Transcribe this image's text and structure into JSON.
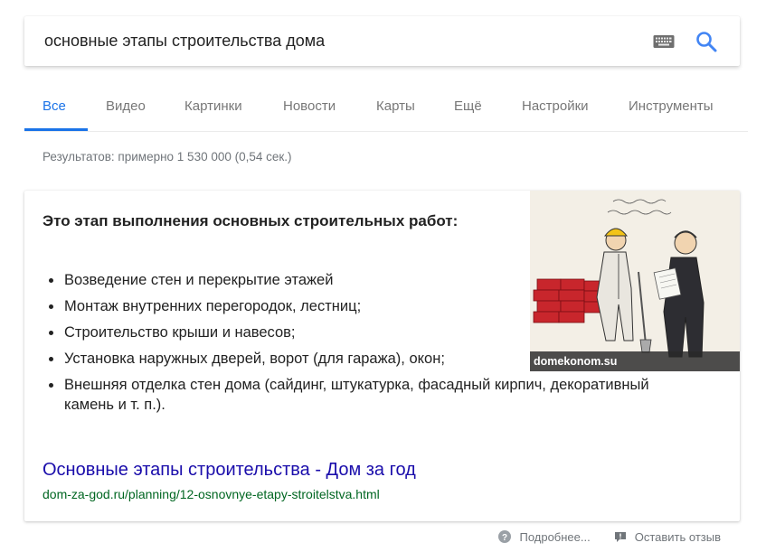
{
  "search": {
    "query": "основные этапы строительства дома",
    "keyboard_icon": "keyboard-icon",
    "search_icon": "search-icon"
  },
  "tabs": [
    {
      "label": "Все",
      "active": true
    },
    {
      "label": "Видео",
      "active": false
    },
    {
      "label": "Картинки",
      "active": false
    },
    {
      "label": "Новости",
      "active": false
    },
    {
      "label": "Карты",
      "active": false
    },
    {
      "label": "Ещё",
      "active": false
    },
    {
      "label": "Настройки",
      "active": false
    },
    {
      "label": "Инструменты",
      "active": false
    }
  ],
  "result_stats": "Результатов: примерно 1 530 000 (0,54 сек.)",
  "snippet": {
    "heading": "Это этап выполнения основных строительных работ:",
    "bullets": [
      "Возведение стен и перекрытие этажей",
      "Монтаж внутренних перегородок, лестниц;",
      "Строительство крыши и навесов;",
      "Установка наружных дверей, ворот (для гаража), окон;",
      "Внешняя отделка стен дома (сайдинг, штукатурка, фасадный кирпич, декоративный камень и т. п.)."
    ],
    "image_caption": "domekonom.su",
    "result_title": "Основные этапы строительства - Дом за год",
    "result_url": "dom-za-god.ru/planning/12-osnovnye-etapy-stroitelstva.html"
  },
  "footer": {
    "more_label": "Подробнее...",
    "feedback_label": "Оставить отзыв"
  },
  "colors": {
    "accent": "#1a73e8",
    "link": "#1a0dab",
    "url": "#006621",
    "muted": "#70757a"
  }
}
